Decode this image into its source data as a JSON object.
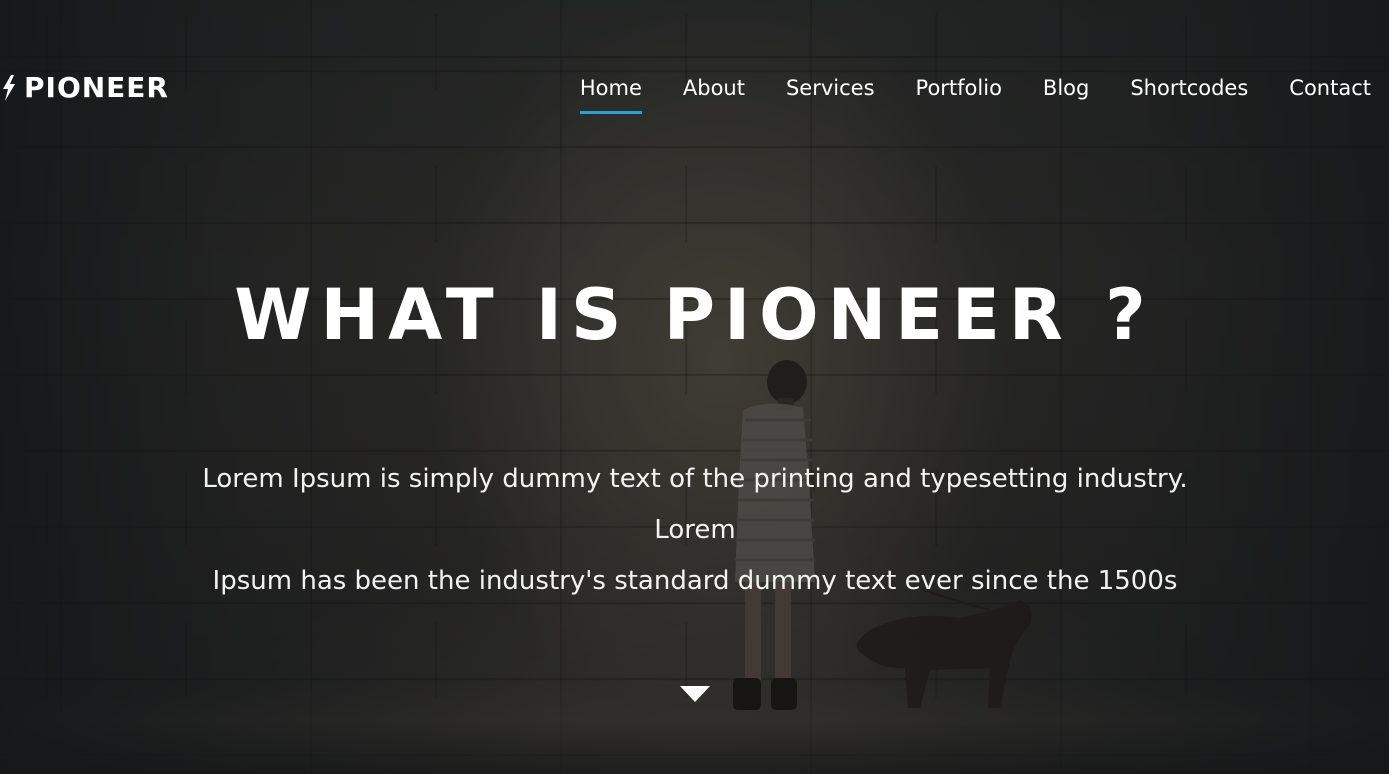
{
  "brand": {
    "logo_text": "PIONEER",
    "logo_icon": "lightning-bolt-icon"
  },
  "nav": {
    "items": [
      {
        "label": "Home",
        "active": true
      },
      {
        "label": "About",
        "active": false
      },
      {
        "label": "Services",
        "active": false
      },
      {
        "label": "Portfolio",
        "active": false
      },
      {
        "label": "Blog",
        "active": false
      },
      {
        "label": "Shortcodes",
        "active": false
      },
      {
        "label": "Contact",
        "active": false
      }
    ]
  },
  "hero": {
    "title": "WHAT IS PIONEER ?",
    "text_line1": "Lorem Ipsum is simply dummy text of the printing and typesetting industry. Lorem",
    "text_line2": "Ipsum has been the industry's standard dummy text ever since the 1500s",
    "scroll_icon": "caret-down-icon"
  },
  "colors": {
    "accent": "#2a9fd8",
    "text": "#ffffff",
    "overlay": "#1e2022"
  }
}
